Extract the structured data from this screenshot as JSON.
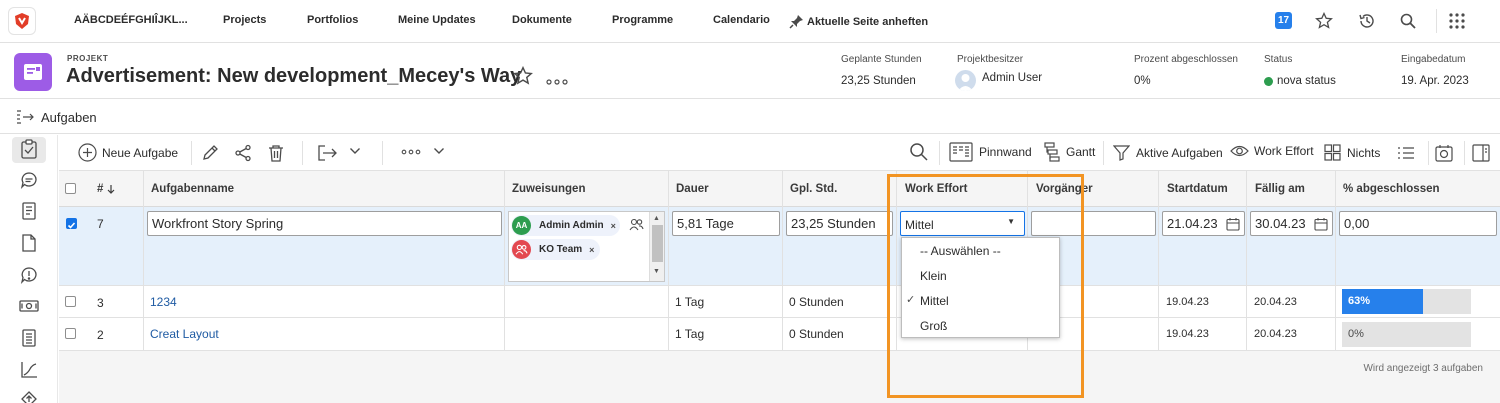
{
  "nav": {
    "items": [
      "AÄBCDEÉFGHIÎJKL...",
      "Projects",
      "Portfolios",
      "Meine Updates",
      "Dokumente",
      "Programme",
      "Calendario"
    ],
    "pin_label": "Aktuelle Seite anheften",
    "badge": "17",
    "brand_color": "#e23d28"
  },
  "project": {
    "type_label": "PROJEKT",
    "title": "Advertisement: New development_Mecey's Way",
    "icon_color": "#9d5ce6",
    "meta": {
      "planned_hours_label": "Geplante Stunden",
      "planned_hours": "23,25 Stunden",
      "owner_label": "Projektbesitzer",
      "owner": "Admin User",
      "percent_label": "Prozent abgeschlossen",
      "percent": "0%",
      "status_label": "Status",
      "status": "nova status",
      "status_color": "#2d9d4f",
      "entry_date_label": "Eingabedatum",
      "entry_date": "19. Apr. 2023"
    }
  },
  "section": {
    "title": "Aufgaben"
  },
  "toolbar": {
    "new_task": "Neue Aufgabe",
    "board": "Pinnwand",
    "gantt": "Gantt",
    "active_tasks": "Aktive Aufgaben",
    "work_effort": "Work Effort",
    "nothing": "Nichts"
  },
  "grid": {
    "headers": {
      "number": "#",
      "name": "Aufgabenname",
      "assignments": "Zuweisungen",
      "duration": "Dauer",
      "planned_hours": "Gpl. Std.",
      "work_effort": "Work Effort",
      "predecessor": "Vorgänger",
      "start": "Startdatum",
      "due": "Fällig am",
      "percent": "% abgeschlossen"
    },
    "edit_row": {
      "number": "7",
      "name": "Workfront Story Spring",
      "assignees": [
        {
          "initials": "AA",
          "name": "Admin Admin",
          "color": "#2d9d4f"
        },
        {
          "initials": "",
          "name": "KO Team",
          "color": "#e34850"
        }
      ],
      "duration": "5,81 Tage",
      "planned_hours": "23,25 Stunden",
      "work_effort": "Mittel",
      "predecessor": "",
      "start": "21.04.23",
      "due": "30.04.23",
      "percent": "0,00"
    },
    "rows": [
      {
        "number": "3",
        "name": "1234",
        "duration": "1 Tag",
        "planned_hours": "0 Stunden",
        "start": "19.04.23",
        "due": "20.04.23",
        "percent_label": "63%",
        "percent": 0.63
      },
      {
        "number": "2",
        "name": "Creat Layout",
        "duration": "1 Tag",
        "planned_hours": "0 Stunden",
        "start": "19.04.23",
        "due": "20.04.23",
        "percent_label": "0%",
        "percent": 0
      }
    ],
    "footer": "Wird angezeigt 3 aufgaben"
  },
  "dropdown": {
    "options": [
      "-- Auswählen --",
      "Klein",
      "Mittel",
      "Groß"
    ],
    "selected": "Mittel"
  },
  "highlight_color": "#f29423"
}
